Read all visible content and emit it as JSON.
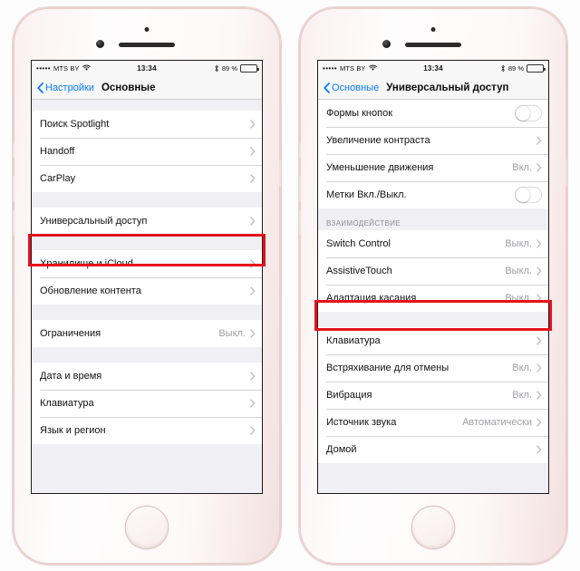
{
  "phones": [
    {
      "id": "left-phone",
      "status_bar": {
        "signal_dots": "•••••",
        "carrier": "MTS BY",
        "wifi_icon": "wifi-icon",
        "time": "13:34",
        "bluetooth_icon": "bluetooth-icon",
        "battery_percent": "89 %",
        "battery_icon": "battery-icon"
      },
      "nav": {
        "back_icon": "chevron-left-icon",
        "back_label": "Настройки",
        "title": "Основные"
      },
      "groups": [
        {
          "header": "",
          "rows": [
            {
              "label": "Поиск Spotlight",
              "value": "",
              "accessory": "chevron"
            },
            {
              "label": "Handoff",
              "value": "",
              "accessory": "chevron"
            },
            {
              "label": "CarPlay",
              "value": "",
              "accessory": "chevron"
            }
          ]
        },
        {
          "header": "",
          "rows": [
            {
              "label": "Универсальный доступ",
              "value": "",
              "accessory": "chevron",
              "highlighted": true
            }
          ]
        },
        {
          "header": "",
          "rows": [
            {
              "label": "Хранилище и iCloud",
              "value": "",
              "accessory": "chevron"
            },
            {
              "label": "Обновление контента",
              "value": "",
              "accessory": "chevron"
            }
          ]
        },
        {
          "header": "",
          "rows": [
            {
              "label": "Ограничения",
              "value": "Выкл.",
              "accessory": "chevron"
            }
          ]
        },
        {
          "header": "",
          "rows": [
            {
              "label": "Дата и время",
              "value": "",
              "accessory": "chevron"
            },
            {
              "label": "Клавиатура",
              "value": "",
              "accessory": "chevron"
            },
            {
              "label": "Язык и регион",
              "value": "",
              "accessory": "chevron"
            }
          ]
        }
      ]
    },
    {
      "id": "right-phone",
      "status_bar": {
        "signal_dots": "•••••",
        "carrier": "MTS BY",
        "wifi_icon": "wifi-icon",
        "time": "13:34",
        "bluetooth_icon": "bluetooth-icon",
        "battery_percent": "89 %",
        "battery_icon": "battery-icon"
      },
      "nav": {
        "back_icon": "chevron-left-icon",
        "back_label": "Основные",
        "title": "Универсальный доступ"
      },
      "groups": [
        {
          "header": "",
          "rows": [
            {
              "label": "Формы кнопок",
              "value": "",
              "accessory": "toggle-off"
            },
            {
              "label": "Увеличение контраста",
              "value": "",
              "accessory": "chevron"
            },
            {
              "label": "Уменьшение движения",
              "value": "Вкл.",
              "accessory": "chevron"
            },
            {
              "label": "Метки Вкл./Выкл.",
              "value": "",
              "accessory": "toggle-off"
            }
          ]
        },
        {
          "header": "ВЗАИМОДЕЙСТВИЕ",
          "rows": [
            {
              "label": "Switch Control",
              "value": "Выкл.",
              "accessory": "chevron"
            },
            {
              "label": "AssistiveTouch",
              "value": "Выкл.",
              "accessory": "chevron",
              "highlighted": true
            },
            {
              "label": "Адаптация касания",
              "value": "Выкл.",
              "accessory": "chevron"
            }
          ]
        },
        {
          "header": "",
          "rows": [
            {
              "label": "Клавиатура",
              "value": "",
              "accessory": "chevron"
            },
            {
              "label": "Встряхивание для отмены",
              "value": "Вкл.",
              "accessory": "chevron"
            },
            {
              "label": "Вибрация",
              "value": "Вкл.",
              "accessory": "chevron"
            },
            {
              "label": "Источник звука",
              "value": "Автоматически",
              "accessory": "chevron"
            },
            {
              "label": "Домой",
              "value": "",
              "accessory": "chevron"
            }
          ]
        }
      ]
    }
  ],
  "annotation": {
    "color": "#e4121b",
    "style": "red-rectangle-highlight"
  },
  "device": {
    "model_color": "rose-gold",
    "home_button": "home-button",
    "camera": "front-camera",
    "speaker": "earpiece-speaker"
  }
}
